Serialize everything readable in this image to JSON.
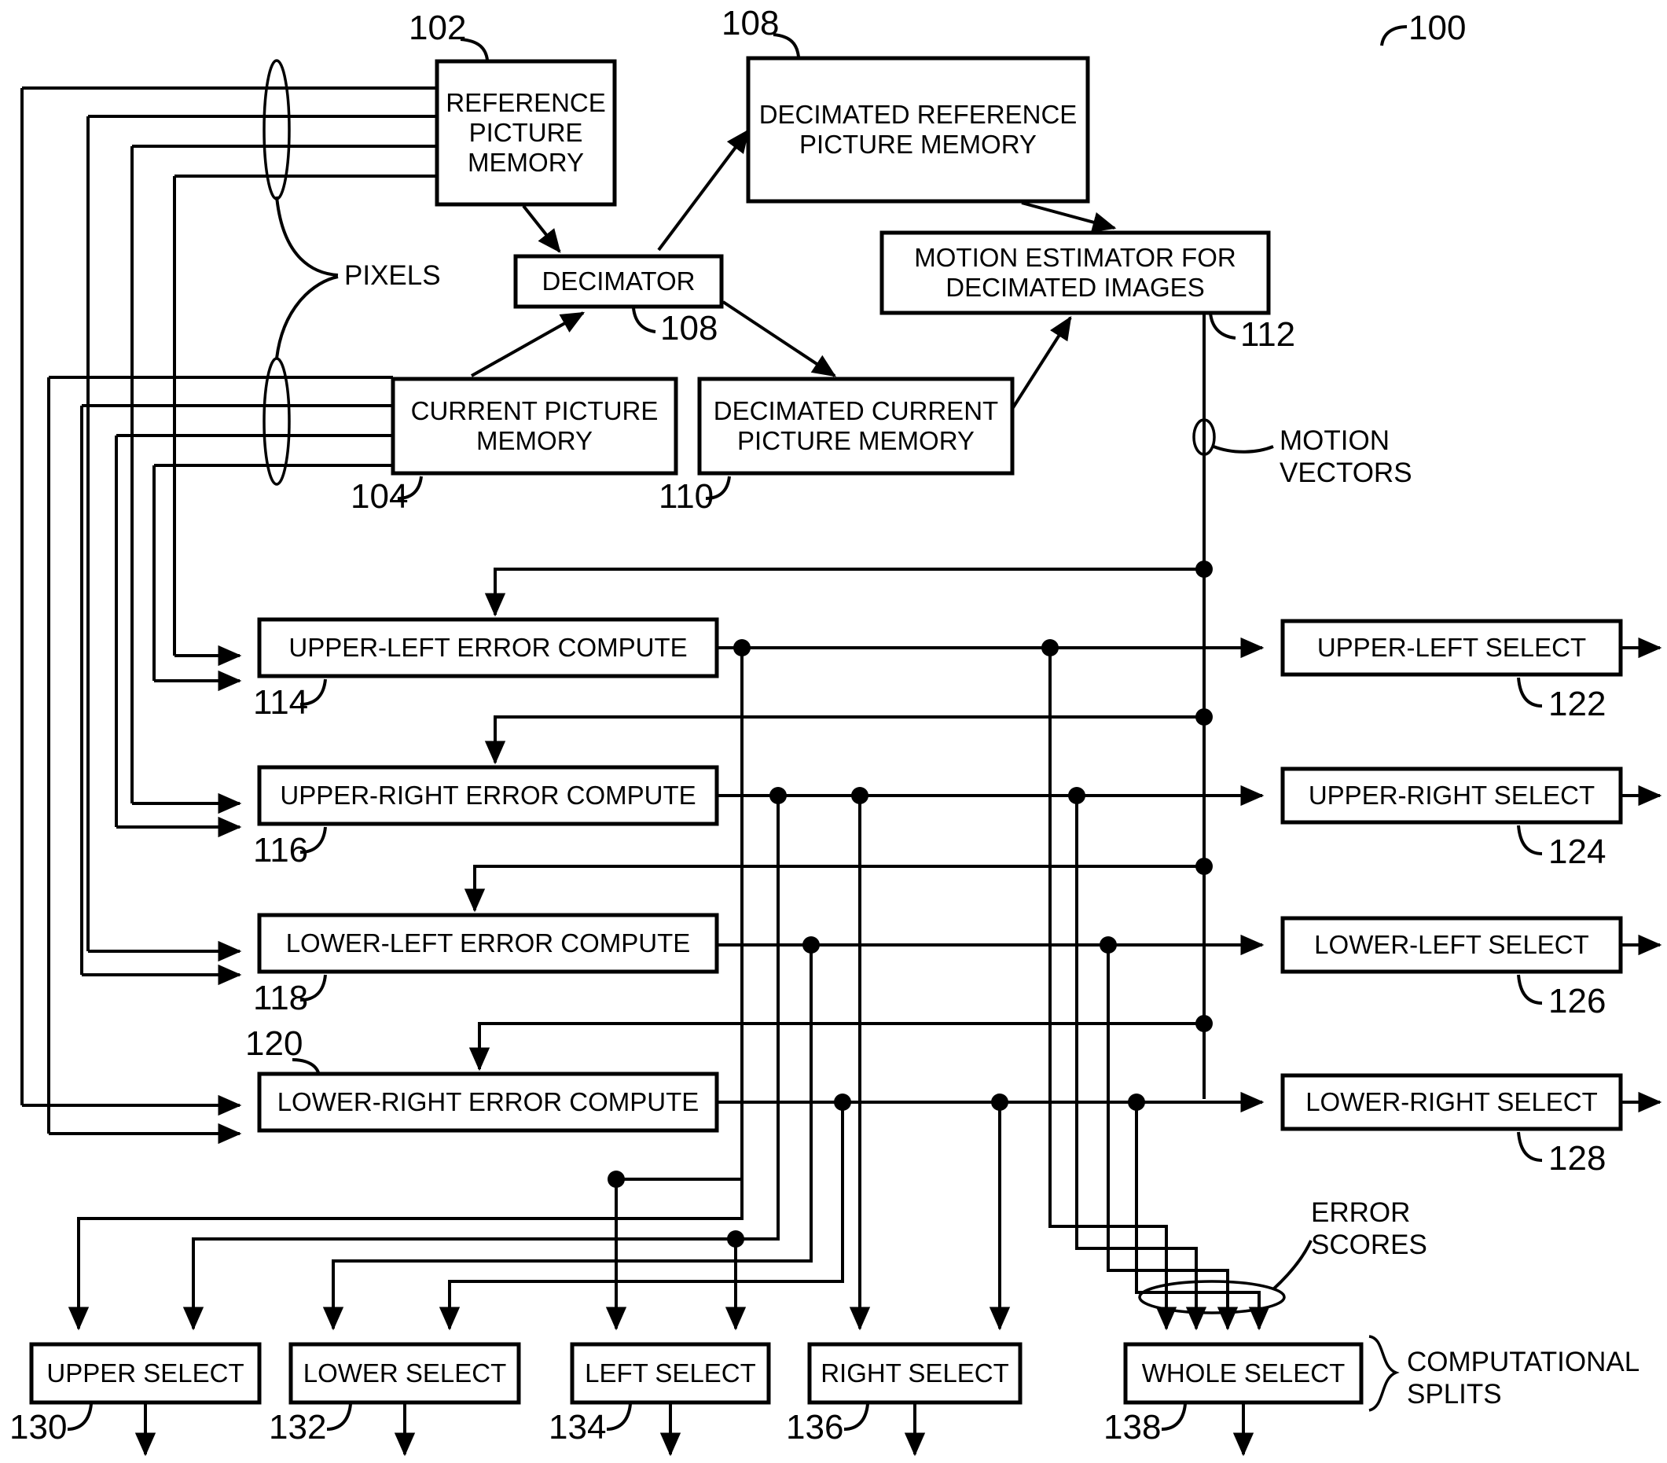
{
  "figure": {
    "figure_ref": "100",
    "blocks": [
      {
        "id": "reference_picture_memory",
        "label": "REFERENCE\nPICTURE\nMEMORY",
        "ref": "102"
      },
      {
        "id": "decimated_reference_picture_memory",
        "label": "DECIMATED REFERENCE\nPICTURE MEMORY",
        "ref": "108"
      },
      {
        "id": "decimator",
        "label": "DECIMATOR",
        "ref": "108"
      },
      {
        "id": "motion_estimator",
        "label": "MOTION ESTIMATOR FOR\nDECIMATED IMAGES",
        "ref": "112"
      },
      {
        "id": "current_picture_memory",
        "label": "CURRENT PICTURE\nMEMORY",
        "ref": "104"
      },
      {
        "id": "decimated_current_picture_memory",
        "label": "DECIMATED CURRENT\nPICTURE MEMORY",
        "ref": "110"
      },
      {
        "id": "upper_left_error_compute",
        "label": "UPPER-LEFT ERROR COMPUTE",
        "ref": "114"
      },
      {
        "id": "upper_right_error_compute",
        "label": "UPPER-RIGHT ERROR COMPUTE",
        "ref": "116"
      },
      {
        "id": "lower_left_error_compute",
        "label": "LOWER-LEFT ERROR COMPUTE",
        "ref": "118"
      },
      {
        "id": "lower_right_error_compute",
        "label": "LOWER-RIGHT ERROR COMPUTE",
        "ref": "120"
      },
      {
        "id": "upper_left_select",
        "label": "UPPER-LEFT SELECT",
        "ref": "122"
      },
      {
        "id": "upper_right_select",
        "label": "UPPER-RIGHT SELECT",
        "ref": "124"
      },
      {
        "id": "lower_left_select",
        "label": "LOWER-LEFT SELECT",
        "ref": "126"
      },
      {
        "id": "lower_right_select",
        "label": "LOWER-RIGHT SELECT",
        "ref": "128"
      },
      {
        "id": "upper_select",
        "label": "UPPER SELECT",
        "ref": "130"
      },
      {
        "id": "lower_select",
        "label": "LOWER SELECT",
        "ref": "132"
      },
      {
        "id": "left_select",
        "label": "LEFT SELECT",
        "ref": "134"
      },
      {
        "id": "right_select",
        "label": "RIGHT SELECT",
        "ref": "136"
      },
      {
        "id": "whole_select",
        "label": "WHOLE SELECT",
        "ref": "138"
      }
    ],
    "annotations": [
      {
        "id": "pixels",
        "label": "PIXELS"
      },
      {
        "id": "motion_vectors",
        "label": "MOTION\nVECTORS"
      },
      {
        "id": "error_scores",
        "label": "ERROR\nSCORES"
      },
      {
        "id": "computational_splits",
        "label": "COMPUTATIONAL\nSPLITS"
      }
    ]
  }
}
